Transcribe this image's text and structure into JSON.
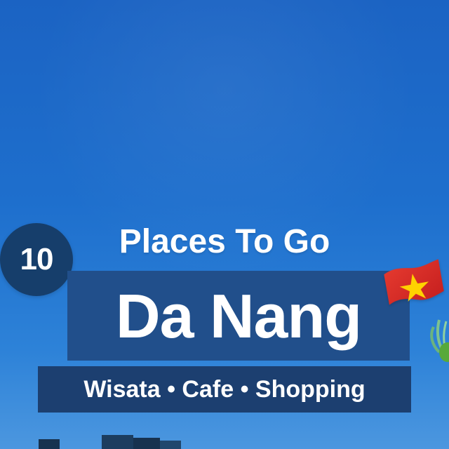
{
  "background": {
    "sky_color": "#1e6fcd"
  },
  "poster": {
    "count": "10",
    "tagline": "Places To Go",
    "city": "Da Nang",
    "subtitle": "Wisata • Cafe • Shopping"
  },
  "decorations": {
    "flag_icon": "vietnam-flag-icon",
    "plant_icon": "plant-icon",
    "skyline_icon": "skyline-icon"
  }
}
